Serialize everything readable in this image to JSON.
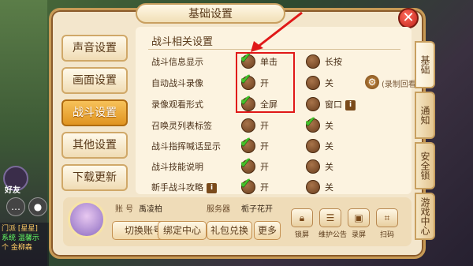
{
  "window_title": "基础设置",
  "left_tabs": [
    {
      "label": "声音设置"
    },
    {
      "label": "画面设置"
    },
    {
      "label": "战斗设置"
    },
    {
      "label": "其他设置"
    },
    {
      "label": "下载更新"
    }
  ],
  "active_left_tab": "战斗设置",
  "section_title": "战斗相关设置",
  "settings": [
    {
      "label": "战斗信息显示",
      "opt1": "单击",
      "opt2": "长按",
      "selected": 1
    },
    {
      "label": "自动战斗录像",
      "opt1": "开",
      "opt2": "关",
      "selected": 1,
      "extra": "(录制回看)"
    },
    {
      "label": "录像观看形式",
      "opt1": "全屏",
      "opt2": "窗口",
      "selected": 1
    },
    {
      "label": "召唤灵列表标签",
      "opt1": "开",
      "opt2": "关",
      "selected": 2
    },
    {
      "label": "战斗指挥喊话显示",
      "opt1": "开",
      "opt2": "关",
      "selected": 1
    },
    {
      "label": "战斗技能说明",
      "opt1": "开",
      "opt2": "关",
      "selected": 1
    },
    {
      "label": "新手战斗攻略",
      "opt1": "开",
      "opt2": "关",
      "selected": 1
    }
  ],
  "right_tabs": [
    {
      "label": "基础"
    },
    {
      "label": "通知"
    },
    {
      "label": "安全锁"
    },
    {
      "label": "游戏中心"
    }
  ],
  "account": {
    "account_label": "账 号",
    "account_value": "禹凌柏",
    "server_label": "服务器",
    "server_value": "栀子花开"
  },
  "buttons": {
    "switch_account": "切换账号",
    "bind_center": "绑定中心",
    "gift_redeem": "礼包兑换",
    "more": "更多"
  },
  "mini_buttons": [
    {
      "label": "锁屏",
      "icon": "lock-icon"
    },
    {
      "label": "维护公告",
      "icon": "notice-icon"
    },
    {
      "label": "录屏",
      "icon": "record-icon"
    },
    {
      "label": "扫码",
      "icon": "scan-icon"
    }
  ],
  "background": {
    "friend_label": "好友",
    "chat_lines": [
      "门派 [星星]",
      "系统 温馨示",
      "个 金柳森"
    ]
  },
  "colors": {
    "check": "#43c12a",
    "highlight": "#e01818",
    "active_tab": "#e09420"
  }
}
